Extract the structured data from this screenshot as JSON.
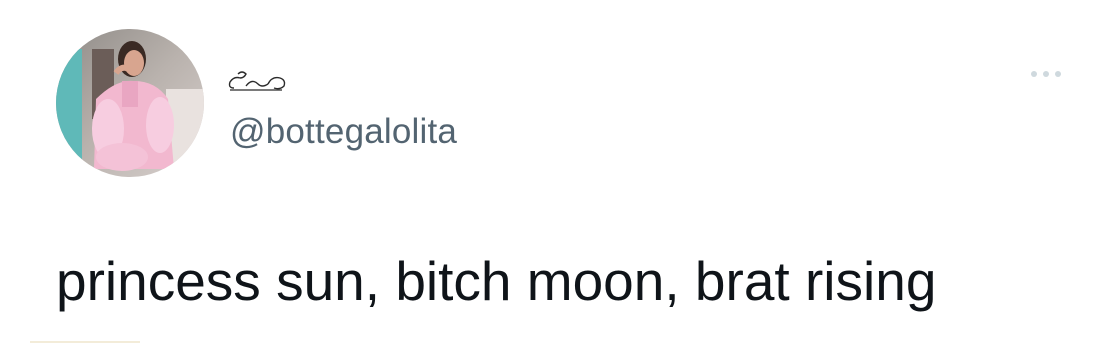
{
  "tweet": {
    "handle": "@bottegalolita",
    "text": "princess sun, bitch moon, brat rising"
  },
  "icons": {
    "more": "more-horizontal-icon",
    "display_name": "handwritten-doodle-name"
  },
  "colors": {
    "text_primary": "#0f1419",
    "text_secondary": "#536471",
    "avatar_pink": "#f2b8cf"
  }
}
